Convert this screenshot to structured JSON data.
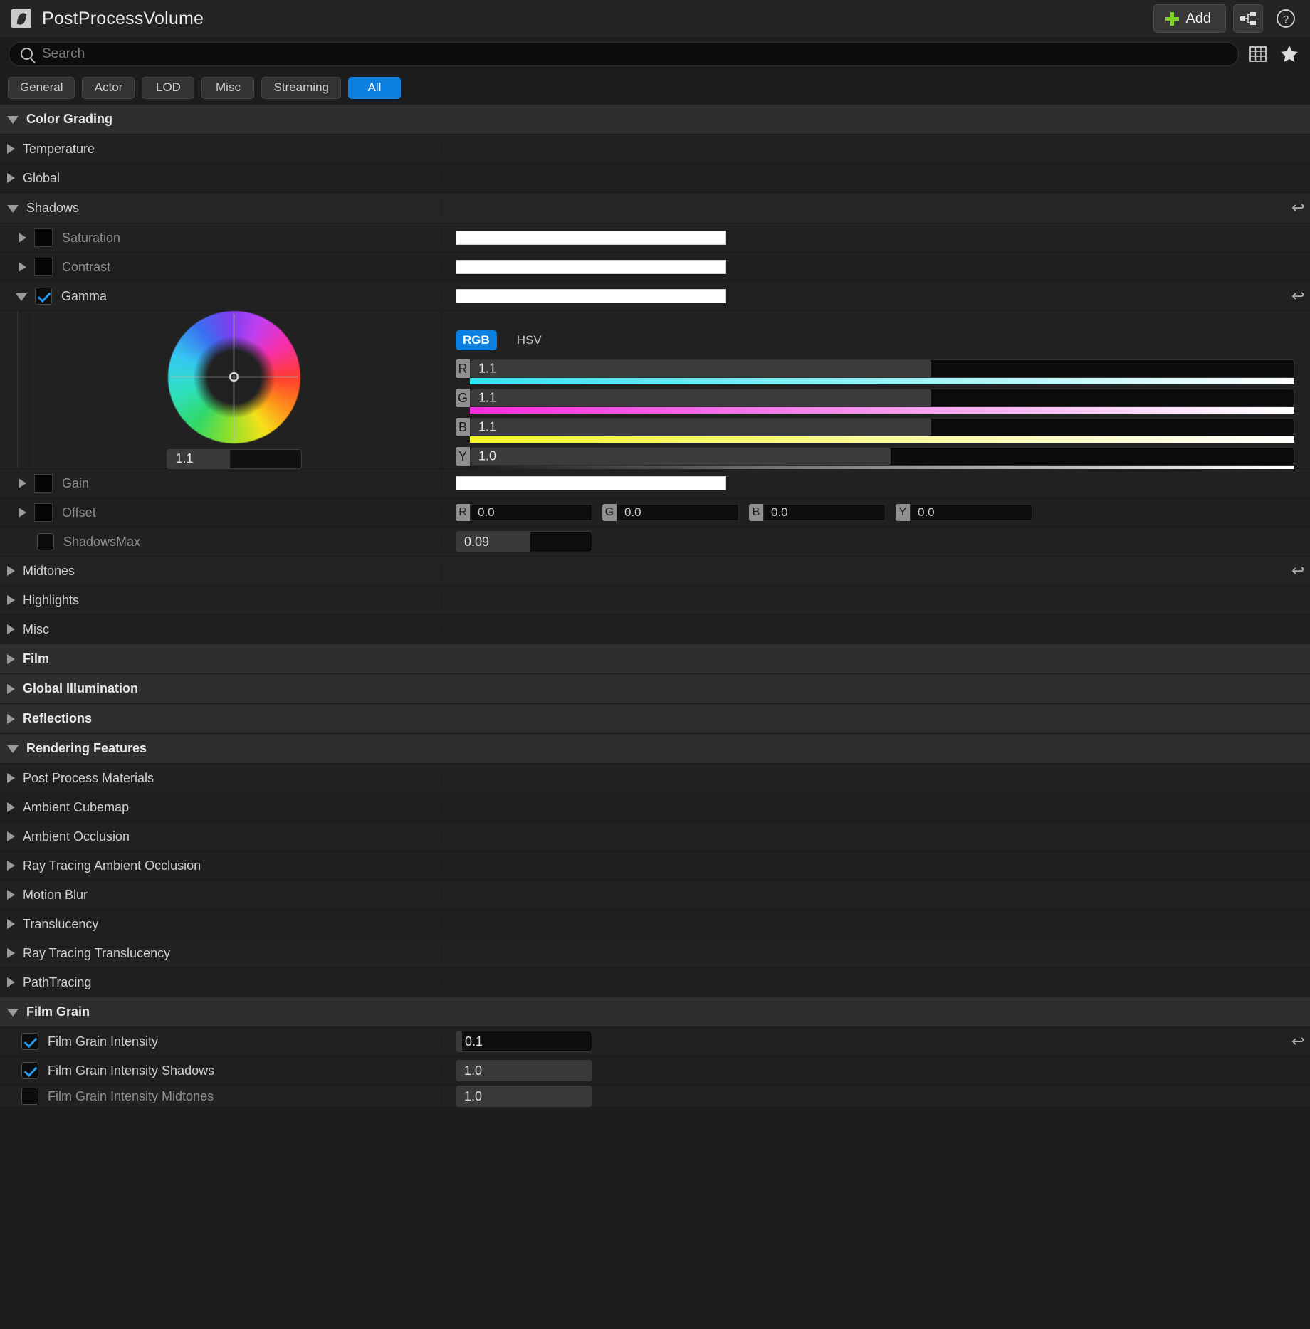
{
  "window": {
    "title": "PostProcessVolume",
    "icon": "postprocessvolume-icon",
    "add_label": "Add",
    "hierarchy_icon": "hierarchy-icon",
    "help_icon": "help-circle-icon"
  },
  "search": {
    "placeholder": "Search",
    "value": "",
    "grid_icon": "grid-view-icon",
    "favorite_icon": "star-icon"
  },
  "filters": [
    {
      "label": "General",
      "active": false
    },
    {
      "label": "Actor",
      "active": false
    },
    {
      "label": "LOD",
      "active": false
    },
    {
      "label": "Misc",
      "active": false
    },
    {
      "label": "Streaming",
      "active": false
    },
    {
      "label": "All",
      "active": true
    }
  ],
  "colors": {
    "accent": "#0c7fe0",
    "add_plus": "#7ed321",
    "checkbox_check": "#1f9cf0",
    "panel_bg": "#212121",
    "category_bg": "#2e2e2e"
  },
  "sections": {
    "color_grading": {
      "label": "Color Grading",
      "expanded": true
    },
    "temperature": {
      "label": "Temperature",
      "expanded": false
    },
    "global": {
      "label": "Global",
      "expanded": false
    },
    "shadows": {
      "label": "Shadows",
      "expanded": true
    },
    "midtones": {
      "label": "Midtones",
      "expanded": false
    },
    "highlights": {
      "label": "Highlights",
      "expanded": false
    },
    "misc": {
      "label": "Misc",
      "expanded": false
    },
    "film": {
      "label": "Film",
      "expanded": false
    },
    "global_illumination": {
      "label": "Global Illumination",
      "expanded": false
    },
    "reflections": {
      "label": "Reflections",
      "expanded": false
    },
    "rendering_features": {
      "label": "Rendering Features",
      "expanded": true
    },
    "film_grain": {
      "label": "Film Grain",
      "expanded": true
    }
  },
  "shadows_props": {
    "saturation": {
      "label": "Saturation",
      "enabled": false
    },
    "contrast": {
      "label": "Contrast",
      "enabled": false
    },
    "gamma": {
      "label": "Gamma",
      "enabled": true
    },
    "gain": {
      "label": "Gain",
      "enabled": false
    },
    "offset": {
      "label": "Offset",
      "enabled": false
    },
    "shadows_max": {
      "label": "ShadowsMax",
      "enabled": false,
      "value": "0.09"
    }
  },
  "offset_channels": [
    {
      "tag": "R",
      "value": "0.0"
    },
    {
      "tag": "G",
      "value": "0.0"
    },
    {
      "tag": "B",
      "value": "0.0"
    },
    {
      "tag": "Y",
      "value": "0.0"
    }
  ],
  "color_picker": {
    "mode_rgb": "RGB",
    "mode_hsv": "HSV",
    "active_mode": "RGB",
    "wheel_value": "1.1",
    "channels": [
      {
        "tag": "R",
        "value": "1.1",
        "fill_pct": 56,
        "grad_from": "#2ee6f0",
        "grad_to": "#ffffff"
      },
      {
        "tag": "G",
        "value": "1.1",
        "fill_pct": 56,
        "grad_from": "#f02ee0",
        "grad_to": "#ffffff"
      },
      {
        "tag": "B",
        "value": "1.1",
        "fill_pct": 56,
        "grad_from": "#f5f52a",
        "grad_to": "#ffffff"
      },
      {
        "tag": "Y",
        "value": "1.0",
        "fill_pct": 51,
        "grad_from": "#2a2a2a",
        "grad_to": "#ffffff"
      }
    ]
  },
  "rendering_items": [
    {
      "label": "Post Process Materials"
    },
    {
      "label": "Ambient Cubemap"
    },
    {
      "label": "Ambient Occlusion"
    },
    {
      "label": "Ray Tracing Ambient Occlusion"
    },
    {
      "label": "Motion Blur"
    },
    {
      "label": "Translucency"
    },
    {
      "label": "Ray Tracing Translucency"
    },
    {
      "label": "PathTracing"
    }
  ],
  "film_grain_items": [
    {
      "label": "Film Grain Intensity",
      "value": "0.1",
      "enabled": true,
      "fill_pct": 3
    },
    {
      "label": "Film Grain Intensity Shadows",
      "value": "1.0",
      "enabled": true,
      "fill_pct": 100
    },
    {
      "label": "Film Grain Intensity Midtones",
      "value": "1.0",
      "enabled": false,
      "fill_pct": 100
    }
  ]
}
